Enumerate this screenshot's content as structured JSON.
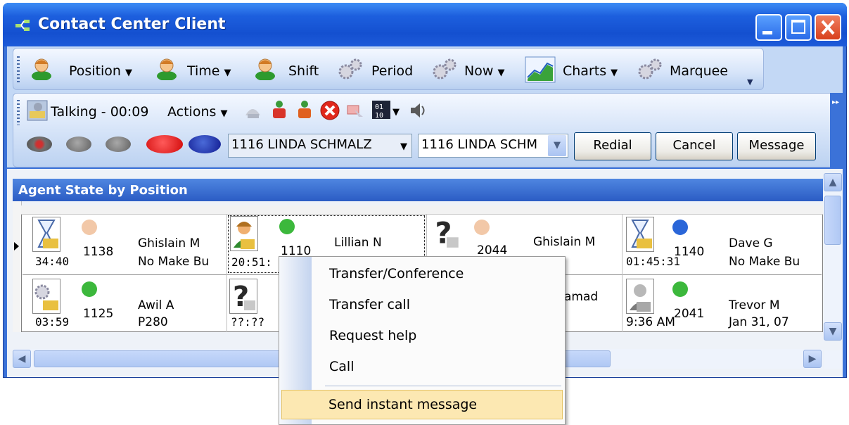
{
  "window": {
    "title": "Contact Center Client"
  },
  "toolbar1": {
    "items": [
      {
        "label": "Position",
        "has_dropdown": true,
        "icon": "agent-person-icon"
      },
      {
        "label": "Time",
        "has_dropdown": true,
        "icon": "agent-person-icon"
      },
      {
        "label": "Shift",
        "has_dropdown": false,
        "icon": "agent-person-icon"
      },
      {
        "label": "Period",
        "has_dropdown": false,
        "icon": "gears-icon"
      },
      {
        "label": "Now",
        "has_dropdown": true,
        "icon": "gears-icon"
      },
      {
        "label": "Charts",
        "has_dropdown": true,
        "icon": "chart-icon"
      },
      {
        "label": "Marquee",
        "has_dropdown": false,
        "icon": "gears-icon"
      }
    ]
  },
  "toolbar2": {
    "status": "Talking - 00:09",
    "actions_label": "Actions",
    "combo_agent": "1116 LINDA SCHMALZ",
    "combo_agent2": "1116 LINDA SCHM",
    "redial_label": "Redial",
    "cancel_label": "Cancel",
    "message_label": "Message"
  },
  "panel": {
    "title": "Agent State by Position",
    "agents": [
      {
        "ext": "1138",
        "name": "Ghislain M",
        "time": "34:40",
        "info": "No Make Bu",
        "status_color": "#f2c8a8",
        "icon": "hourglass-phone-icon"
      },
      {
        "ext": "1110",
        "name": "Lillian N",
        "time": "20:51:",
        "info": "",
        "status_color": "#3cb83c",
        "icon": "agent-headset-icon"
      },
      {
        "ext": "2044",
        "name": "Ghislain M",
        "time": "",
        "info": "",
        "status_color": "#f2c8a8",
        "icon": "unknown-question-icon"
      },
      {
        "ext": "1140",
        "name": "Dave G",
        "time": "01:45:31",
        "info": "No Make Bu",
        "status_color": "#2a66d8",
        "icon": "hourglass-phone-icon"
      },
      {
        "ext": "1125",
        "name": "Awil A",
        "time": "03:59",
        "info": "P280",
        "status_color": "#3cb83c",
        "icon": "gears-phone-icon"
      },
      {
        "ext": "",
        "name": "amad",
        "time": "??:??",
        "info": "",
        "status_color": "",
        "icon": "unknown-question-icon"
      },
      {
        "ext": "2041",
        "name": "Trevor M",
        "time": "9:36 AM",
        "info": "Jan 31, 07",
        "status_color": "#3cb83c",
        "icon": "agent-headset-gray-icon"
      }
    ]
  },
  "context_menu": {
    "items": [
      "Transfer/Conference",
      "Transfer call",
      "Request help",
      "Call"
    ],
    "highlighted": "Send instant message"
  }
}
